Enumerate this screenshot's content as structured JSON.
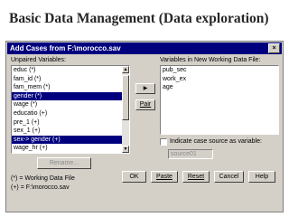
{
  "slide": {
    "title": "Basic Data Management (Data exploration)"
  },
  "dialog": {
    "title": "Add Cases from F:\\morocco.sav",
    "close_glyph": "×",
    "unpaired": {
      "label": "Unpaired Variables:",
      "items": [
        {
          "text": "educ (*)",
          "selected": false
        },
        {
          "text": "fam_id (*)",
          "selected": false
        },
        {
          "text": "fam_mem (*)",
          "selected": false
        },
        {
          "text": "gender (*)",
          "selected": true
        },
        {
          "text": "wage (*)",
          "selected": false
        },
        {
          "text": "educatio (+)",
          "selected": false
        },
        {
          "text": "pre_1 (+)",
          "selected": false
        },
        {
          "text": "sex_1 (+)",
          "selected": false
        },
        {
          "text": "sex-> gender (+)",
          "selected": true
        },
        {
          "text": "wage_hr (+)",
          "selected": false
        }
      ]
    },
    "new_vars": {
      "label": "Variables in New Working Data File:",
      "items": [
        "pub_sec",
        "work_ex",
        "age"
      ]
    },
    "move_arrow": "▶",
    "pair_label": "Pair",
    "rename_label": "Rename...",
    "indicate_label": "Indicate case source as variable:",
    "indicate_value": "source01",
    "legend_1": "(*) = Working Data File",
    "legend_2": "(+) = F:\\morocco.sav",
    "buttons": {
      "ok": "OK",
      "paste": "Paste",
      "reset": "Reset",
      "cancel": "Cancel",
      "help": "Help"
    },
    "scroll_up": "▲",
    "scroll_down": "▼"
  }
}
